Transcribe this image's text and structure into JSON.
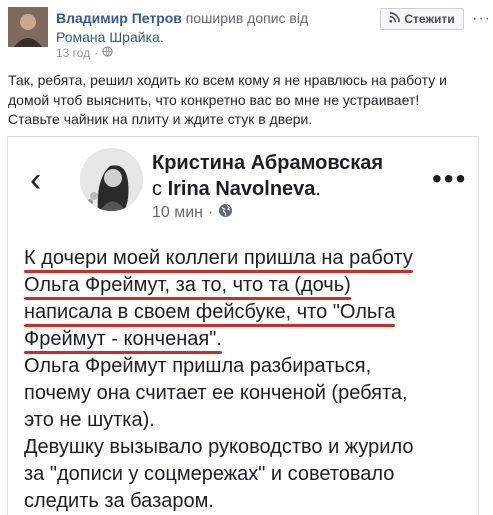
{
  "post": {
    "author": "Владимир Петров",
    "shared_text": " поширив допис від",
    "origin_author": "Романа Шрайка.",
    "time": "13 год",
    "dot": "·",
    "follow_label": "Стежити",
    "more": "···",
    "text_lines": [
      "Так, ребята, решил ходить ко всем кому я не нравлюсь на работу и",
      "домой чтоб выяснить, что конкретно вас во мне не устраивает!",
      "Ставьте чайник на плиту и ждите стук в двери."
    ]
  },
  "screenshot": {
    "name": "Кристина Абрамовская",
    "with_prefix": "с ",
    "with_name": "Irina Navolneva",
    "with_suffix": ".",
    "time": "10 мин",
    "dot": "·",
    "more": "•••",
    "back": "‹",
    "underlined_lines": [
      "К дочери моей коллеги пришла на работу",
      "Ольга Фреймут, за то, что та (дочь)",
      "написала в своем фейсбуке, что \"Ольга",
      "Фреймут - конченая\"."
    ],
    "plain_lines": [
      "Ольга Фреймут пришла разбираться,",
      "почему она считает ее конченой (ребята,",
      "это не шутка).",
      "Девушку вызывало руководство и журило",
      "за \"дописи у соцмережах\" и советовало",
      "следить за базаром."
    ]
  },
  "colors": {
    "link": "#365899",
    "underline": "#d42a22",
    "meta": "#90949c"
  },
  "icons": {
    "globe": "globe-icon",
    "rss": "rss-icon"
  }
}
